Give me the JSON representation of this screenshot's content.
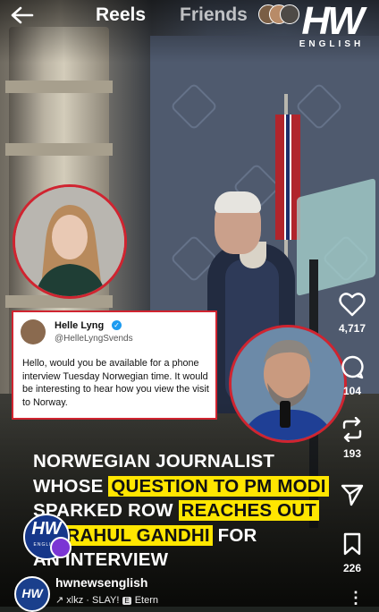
{
  "nav": {
    "tabs": [
      {
        "label": "Reels",
        "active": true
      },
      {
        "label": "Friends",
        "active": false
      }
    ]
  },
  "logo": {
    "mark": "HW",
    "sub": "ENGLISH"
  },
  "tweet": {
    "name": "Helle Lyng",
    "handle": "@HelleLyngSvends",
    "text": "Hello, would you be available for a phone interview Tuesday Norwegian time. It would be interesting to hear how you view the visit to Norway."
  },
  "headline": {
    "line1": "NORWEGIAN JOURNALIST",
    "line2_plain": "WHOSE ",
    "line2_hl": "QUESTION TO PM MODI",
    "line3_plain": "SPARKED ROW ",
    "line3_hl": "REACHES OUT",
    "line4_hl": "TO RAHUL GANDHI",
    "line4_plain": " FOR",
    "line5": "AN INTERVIEW"
  },
  "actions": {
    "likes": "4,717",
    "comments": "104",
    "reposts": "193",
    "saves": "226"
  },
  "channel": {
    "name": "hwnewsenglish",
    "avatar_mark": "HW",
    "audio_artist": "xlkz · SLAY!",
    "audio_badge": "E",
    "audio_track": "Etern"
  },
  "colors": {
    "highlight": "#ffe600",
    "border_red": "#d02430",
    "verified_blue": "#1d9bf0"
  }
}
